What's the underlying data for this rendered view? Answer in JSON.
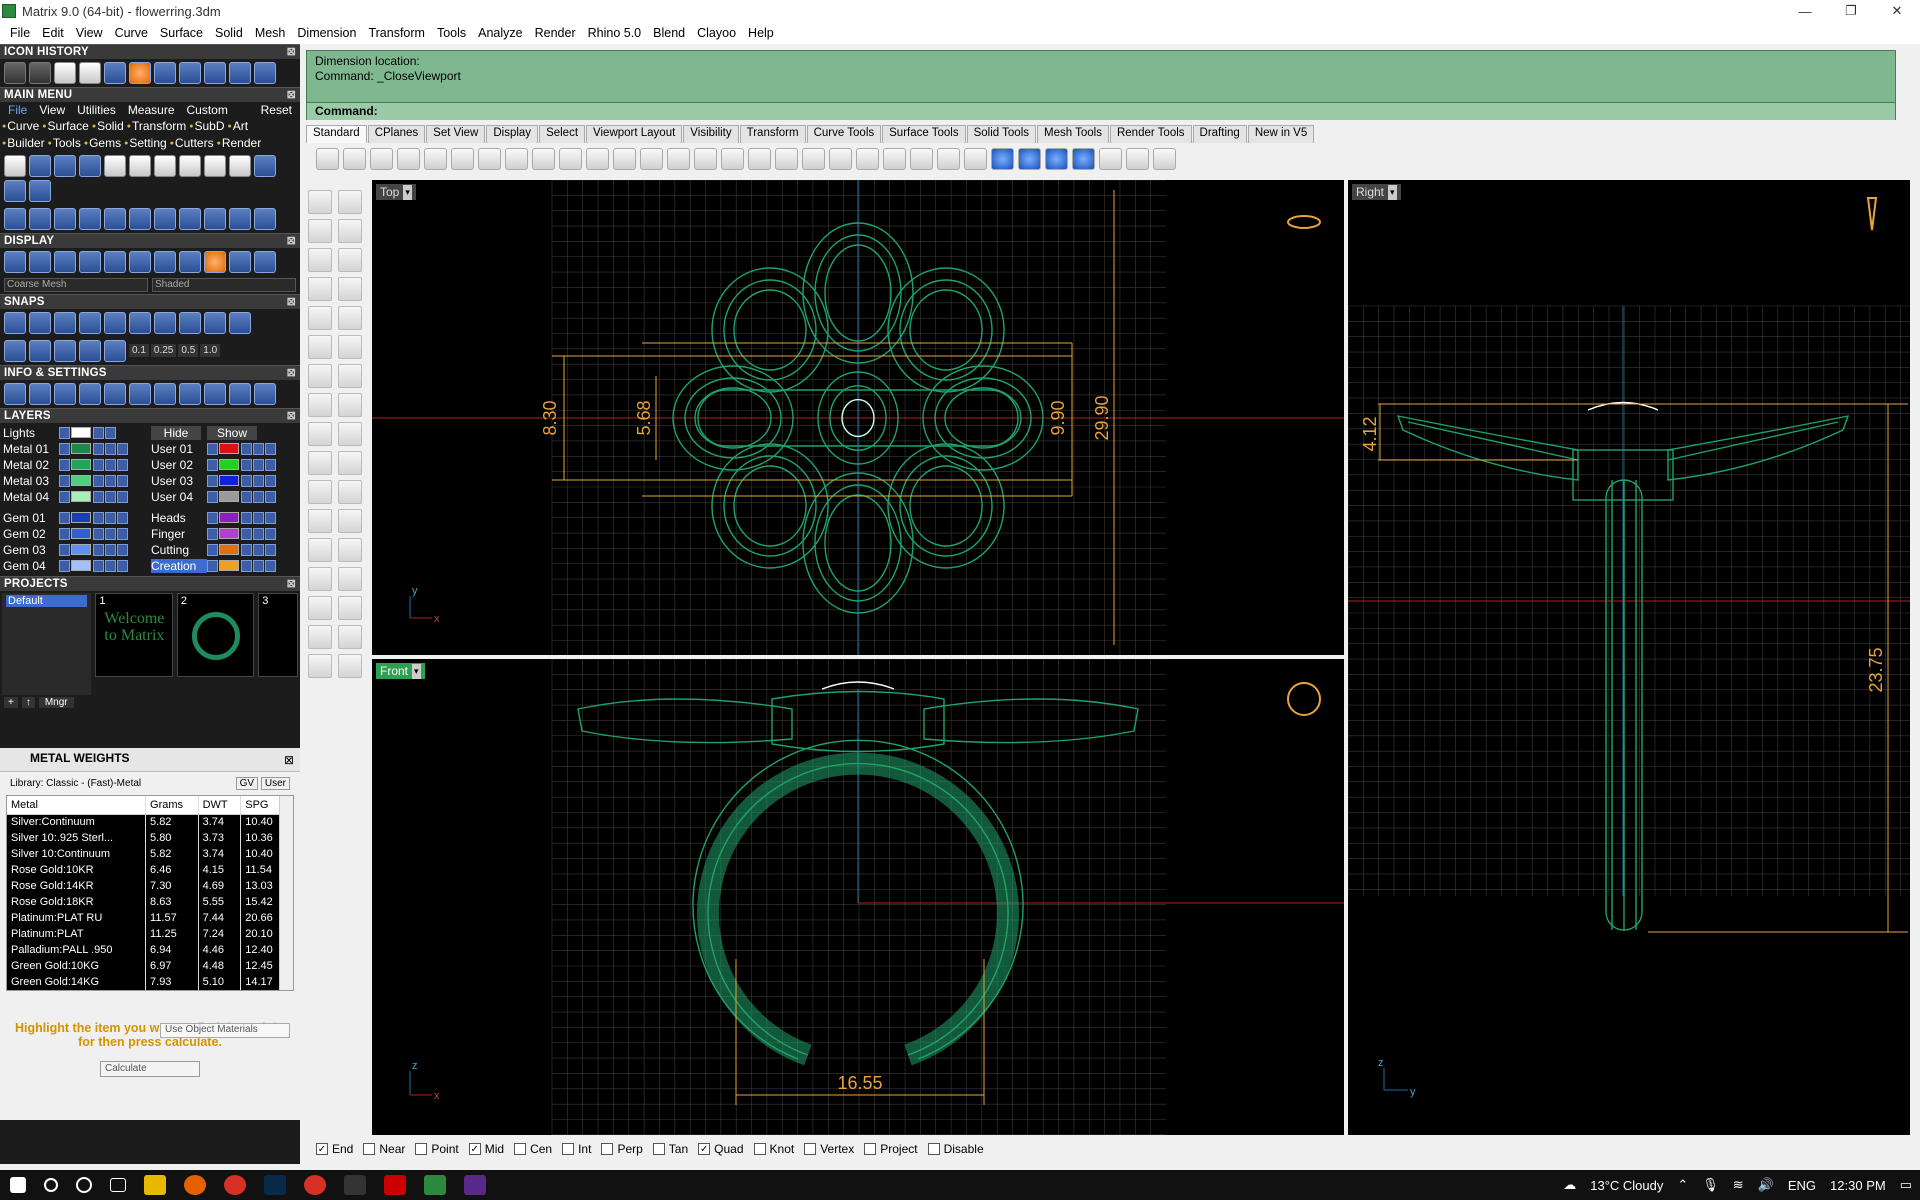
{
  "window": {
    "title": "Matrix 9.0 (64-bit) - flowerring.3dm",
    "minimize": "—",
    "restore": "❐",
    "close": "✕"
  },
  "menu": [
    "File",
    "Edit",
    "View",
    "Curve",
    "Surface",
    "Solid",
    "Mesh",
    "Dimension",
    "Transform",
    "Tools",
    "Analyze",
    "Render",
    "Rhino 5.0",
    "Blend",
    "Clayoo",
    "Help"
  ],
  "panels": {
    "icon_history": "ICON HISTORY",
    "main_menu": "MAIN MENU",
    "display": "DISPLAY",
    "snaps": "SNAPS",
    "info_settings": "INFO & SETTINGS",
    "layers": "LAYERS",
    "projects": "PROJECTS",
    "close": "⊠"
  },
  "main_menu": {
    "tabs": [
      "File",
      "View",
      "Utilities",
      "Measure",
      "Custom"
    ],
    "reset": "Reset",
    "row1": [
      "Curve",
      "Surface",
      "Solid",
      "Transform",
      "SubD",
      "Art"
    ],
    "row2": [
      "Builder",
      "Tools",
      "Gems",
      "Setting",
      "Cutters",
      "Render"
    ]
  },
  "display": {
    "mesh": "Coarse Mesh",
    "mode": "Shaded"
  },
  "snaps": {
    "values": [
      "0.1",
      "0.25",
      "0.5",
      "1.0"
    ]
  },
  "layers": {
    "lights": "Lights",
    "hide": "Hide",
    "show": "Show",
    "rows": [
      [
        {
          "name": "Metal 01",
          "color": "#1b8a4a"
        },
        {
          "name": "User 01",
          "color": "#e01010"
        }
      ],
      [
        {
          "name": "Metal 02",
          "color": "#25a35a"
        },
        {
          "name": "User 02",
          "color": "#22d022"
        }
      ],
      [
        {
          "name": "Metal 03",
          "color": "#4fd07a"
        },
        {
          "name": "User 03",
          "color": "#1020e0"
        }
      ],
      [
        {
          "name": "Metal 04",
          "color": "#a8f0b8"
        },
        {
          "name": "User 04",
          "color": "#9a9a9a"
        }
      ],
      [
        {
          "name": "Gem 01",
          "color": "#1a3fb0"
        },
        {
          "name": "Heads",
          "color": "#8a20c0"
        }
      ],
      [
        {
          "name": "Gem 02",
          "color": "#2f5fd0"
        },
        {
          "name": "Finger",
          "color": "#b040d0"
        }
      ],
      [
        {
          "name": "Gem 03",
          "color": "#5f8ff0"
        },
        {
          "name": "Cutting",
          "color": "#e07010"
        }
      ],
      [
        {
          "name": "Gem 04",
          "color": "#a0c0ff"
        },
        {
          "name": "Creation",
          "color": "#f0a020"
        }
      ]
    ]
  },
  "projects": {
    "default": "Default",
    "thumbs": [
      {
        "n": "1",
        "label": "Welcome to Matrix"
      },
      {
        "n": "2"
      },
      {
        "n": "3"
      }
    ],
    "mngr": "Mngr"
  },
  "metal_weights": {
    "title": "METAL WEIGHTS",
    "library": "Library: Classic - (Fast)-Metal",
    "gv": "GV",
    "user": "User",
    "columns": [
      "Metal",
      "Grams",
      "DWT",
      "SPG"
    ],
    "rows": [
      [
        "Silver:Continuum",
        "5.82",
        "3.74",
        "10.40"
      ],
      [
        "Silver 10:.925 Sterl...",
        "5.80",
        "3.73",
        "10.36"
      ],
      [
        "Silver 10:Continuum",
        "5.82",
        "3.74",
        "10.40"
      ],
      [
        "Rose Gold:10KR",
        "6.46",
        "4.15",
        "11.54"
      ],
      [
        "Rose Gold:14KR",
        "7.30",
        "4.69",
        "13.03"
      ],
      [
        "Rose Gold:18KR",
        "8.63",
        "5.55",
        "15.42"
      ],
      [
        "Platinum:PLAT RU",
        "11.57",
        "7.44",
        "20.66"
      ],
      [
        "Platinum:PLAT",
        "11.25",
        "7.24",
        "20.10"
      ],
      [
        "Palladium:PALL .950",
        "6.94",
        "4.46",
        "12.40"
      ],
      [
        "Green Gold:10KG",
        "6.97",
        "4.48",
        "12.45"
      ],
      [
        "Green Gold:14KG",
        "7.93",
        "5.10",
        "14.17"
      ]
    ],
    "use_object": "Use Object Materials",
    "note": "Highlight the item you want to find the weight for then press calculate.",
    "calculate": "Calculate"
  },
  "command": {
    "history": [
      "Dimension location:",
      "Command: _CloseViewport"
    ],
    "prompt": "Command:"
  },
  "tabs": [
    "Standard",
    "CPlanes",
    "Set View",
    "Display",
    "Select",
    "Viewport Layout",
    "Visibility",
    "Transform",
    "Curve Tools",
    "Surface Tools",
    "Solid Tools",
    "Mesh Tools",
    "Render Tools",
    "Drafting",
    "New in V5"
  ],
  "viewports": {
    "top": {
      "label": "Top",
      "dims": [
        "8.30",
        "5.68",
        "9.90",
        "29.90"
      ]
    },
    "right": {
      "label": "Right",
      "dims": [
        "4.12",
        "23.75"
      ]
    },
    "front": {
      "label": "Front",
      "dims": [
        "16.55"
      ]
    }
  },
  "axes": {
    "x": "x",
    "y": "y",
    "z": "z"
  },
  "snapbar": [
    {
      "label": "End",
      "checked": true
    },
    {
      "label": "Near",
      "checked": false
    },
    {
      "label": "Point",
      "checked": false
    },
    {
      "label": "Mid",
      "checked": true
    },
    {
      "label": "Cen",
      "checked": false
    },
    {
      "label": "Int",
      "checked": false
    },
    {
      "label": "Perp",
      "checked": false
    },
    {
      "label": "Tan",
      "checked": false
    },
    {
      "label": "Quad",
      "checked": true
    },
    {
      "label": "Knot",
      "checked": false
    },
    {
      "label": "Vertex",
      "checked": false
    },
    {
      "label": "Project",
      "checked": false
    },
    {
      "label": "Disable",
      "checked": false
    }
  ],
  "taskbar": {
    "weather": "13°C Cloudy",
    "lang": "ENG",
    "time": "12:30 PM"
  },
  "colors": {
    "wire": "#1fa36a",
    "dim": "#e8a33a",
    "grid": "#3a3a3a",
    "command_bg": "#7fb88f"
  }
}
